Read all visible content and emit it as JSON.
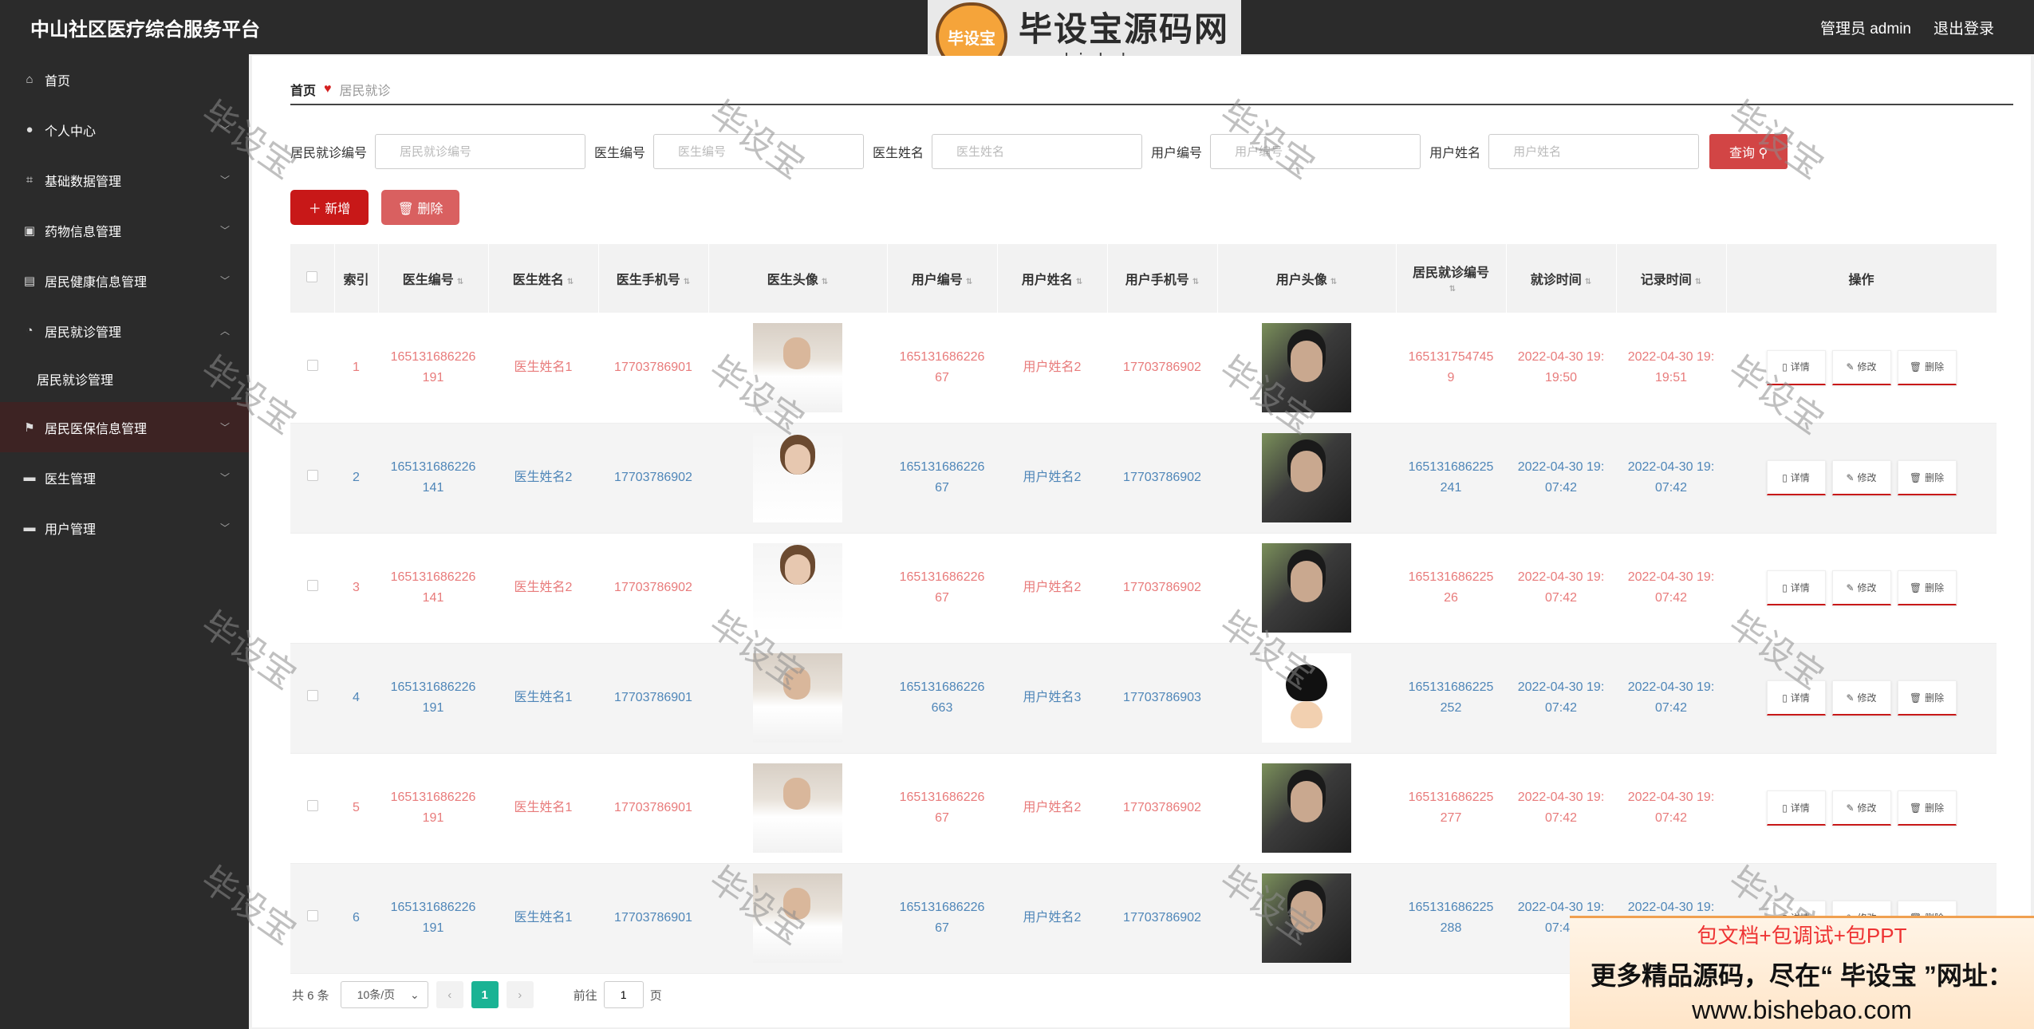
{
  "header": {
    "app_title": "中山社区医疗综合服务平台",
    "admin_label": "管理员 admin",
    "logout_label": "退出登录"
  },
  "logo": {
    "badge": "毕设宝",
    "title": "毕设宝源码网",
    "url": "www.bishebao.com"
  },
  "sidebar": {
    "items": [
      {
        "label": "首页",
        "icon": "home-icon"
      },
      {
        "label": "个人中心",
        "icon": "user-icon"
      },
      {
        "label": "基础数据管理",
        "icon": "crop-icon"
      },
      {
        "label": "药物信息管理",
        "icon": "clipboard-icon"
      },
      {
        "label": "居民健康信息管理",
        "icon": "chart-icon"
      },
      {
        "label": "居民就诊管理",
        "icon": "bell-icon"
      },
      {
        "label": "居民医保信息管理",
        "icon": "flag-icon"
      },
      {
        "label": "医生管理",
        "icon": "message-icon"
      },
      {
        "label": "用户管理",
        "icon": "folder-icon"
      }
    ],
    "sub_item": "居民就诊管理"
  },
  "breadcrumb": {
    "home": "首页",
    "current": "居民就诊"
  },
  "search": {
    "fields": [
      {
        "label": "居民就诊编号",
        "placeholder": "居民就诊编号"
      },
      {
        "label": "医生编号",
        "placeholder": "医生编号"
      },
      {
        "label": "医生姓名",
        "placeholder": "医生姓名"
      },
      {
        "label": "用户编号",
        "placeholder": "用户编号"
      },
      {
        "label": "用户姓名",
        "placeholder": "用户姓名"
      }
    ],
    "button": "查询"
  },
  "actions": {
    "add": "新增",
    "delete": "删除"
  },
  "table": {
    "headers": [
      "索引",
      "医生编号",
      "医生姓名",
      "医生手机号",
      "医生头像",
      "用户编号",
      "用户姓名",
      "用户手机号",
      "用户头像",
      "居民就诊编号",
      "就诊时间",
      "记录时间",
      "操作"
    ],
    "op_labels": {
      "detail": "详情",
      "edit": "修改",
      "delete": "删除"
    },
    "rows": [
      {
        "index": "1",
        "doctor_no": "165131686226191",
        "doctor_name": "医生姓名1",
        "doctor_phone": "17703786901",
        "doctor_avatar": "male-doctor",
        "user_no": "16513168622667",
        "user_name": "用户姓名2",
        "user_phone": "17703786902",
        "user_avatar": "man-portrait",
        "visit_no": "1651317547459",
        "visit_time": "2022-04-30 19:19:50",
        "record_time": "2022-04-30 19:19:51"
      },
      {
        "index": "2",
        "doctor_no": "165131686226141",
        "doctor_name": "医生姓名2",
        "doctor_phone": "17703786902",
        "doctor_avatar": "female-doctor",
        "user_no": "16513168622667",
        "user_name": "用户姓名2",
        "user_phone": "17703786902",
        "user_avatar": "man-portrait",
        "visit_no": "165131686225241",
        "visit_time": "2022-04-30 19:07:42",
        "record_time": "2022-04-30 19:07:42"
      },
      {
        "index": "3",
        "doctor_no": "165131686226141",
        "doctor_name": "医生姓名2",
        "doctor_phone": "17703786902",
        "doctor_avatar": "female-doctor",
        "user_no": "16513168622667",
        "user_name": "用户姓名2",
        "user_phone": "17703786902",
        "user_avatar": "man-portrait",
        "visit_no": "16513168622526",
        "visit_time": "2022-04-30 19:07:42",
        "record_time": "2022-04-30 19:07:42"
      },
      {
        "index": "4",
        "doctor_no": "165131686226191",
        "doctor_name": "医生姓名1",
        "doctor_phone": "17703786901",
        "doctor_avatar": "male-doctor",
        "user_no": "165131686226663",
        "user_name": "用户姓名3",
        "user_phone": "17703786903",
        "user_avatar": "cartoon-boy",
        "visit_no": "165131686225252",
        "visit_time": "2022-04-30 19:07:42",
        "record_time": "2022-04-30 19:07:42"
      },
      {
        "index": "5",
        "doctor_no": "165131686226191",
        "doctor_name": "医生姓名1",
        "doctor_phone": "17703786901",
        "doctor_avatar": "male-doctor",
        "user_no": "16513168622667",
        "user_name": "用户姓名2",
        "user_phone": "17703786902",
        "user_avatar": "man-portrait",
        "visit_no": "165131686225277",
        "visit_time": "2022-04-30 19:07:42",
        "record_time": "2022-04-30 19:07:42"
      },
      {
        "index": "6",
        "doctor_no": "165131686226191",
        "doctor_name": "医生姓名1",
        "doctor_phone": "17703786901",
        "doctor_avatar": "male-doctor",
        "user_no": "16513168622667",
        "user_name": "用户姓名2",
        "user_phone": "17703786902",
        "user_avatar": "man-portrait",
        "visit_no": "165131686225288",
        "visit_time": "2022-04-30 19:07:42",
        "record_time": "2022-04-30 19:07:42"
      }
    ]
  },
  "pagination": {
    "total": "共 6 条",
    "page_size": "10条/页",
    "current_page": "1",
    "goto_prefix": "前往",
    "goto_value": "1",
    "goto_suffix": "页"
  },
  "watermark": "毕设宝",
  "ad": {
    "line1": "包文档+包调试+包PPT",
    "line2": "更多精品源码，尽在“ 毕设宝 ”网址：",
    "line3": "www.bishebao.com"
  },
  "colors": {
    "accent_red": "#c81818",
    "odd_row_text": "#e87b7b",
    "even_row_text": "#4f86b8",
    "page_active": "#1ab394"
  }
}
